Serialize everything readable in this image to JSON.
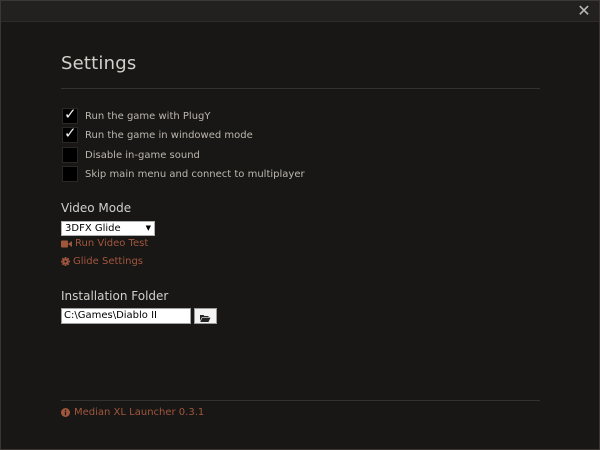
{
  "window": {
    "close_glyph": "✕"
  },
  "settings": {
    "title": "Settings",
    "options": [
      {
        "label": "Run the game with PlugY",
        "checked": true
      },
      {
        "label": "Run the game in windowed mode",
        "checked": true
      },
      {
        "label": "Disable in-game sound",
        "checked": false
      },
      {
        "label": "Skip main menu and connect to multiplayer",
        "checked": false
      }
    ],
    "tick_glyph": "✓"
  },
  "video": {
    "heading": "Video Mode",
    "selected": "3DFX Glide",
    "dropdown_glyph": "▼",
    "run_test_label": "Run Video Test",
    "run_test_icon": "video-camera-icon",
    "glide_settings_label": "Glide Settings",
    "glide_settings_icon": "gear-icon"
  },
  "install": {
    "heading": "Installation Folder",
    "path": "C:\\Games\\Diablo II",
    "browse_icon": "folder-open-icon"
  },
  "footer": {
    "text": "Median XL Launcher 0.3.1",
    "icon": "info-circle-icon"
  },
  "colors": {
    "background": "#181716",
    "titlebar": "#232120",
    "heading_text": "#d3cfca",
    "body_text": "#bdb6ae",
    "accent_link": "#a0563c"
  }
}
